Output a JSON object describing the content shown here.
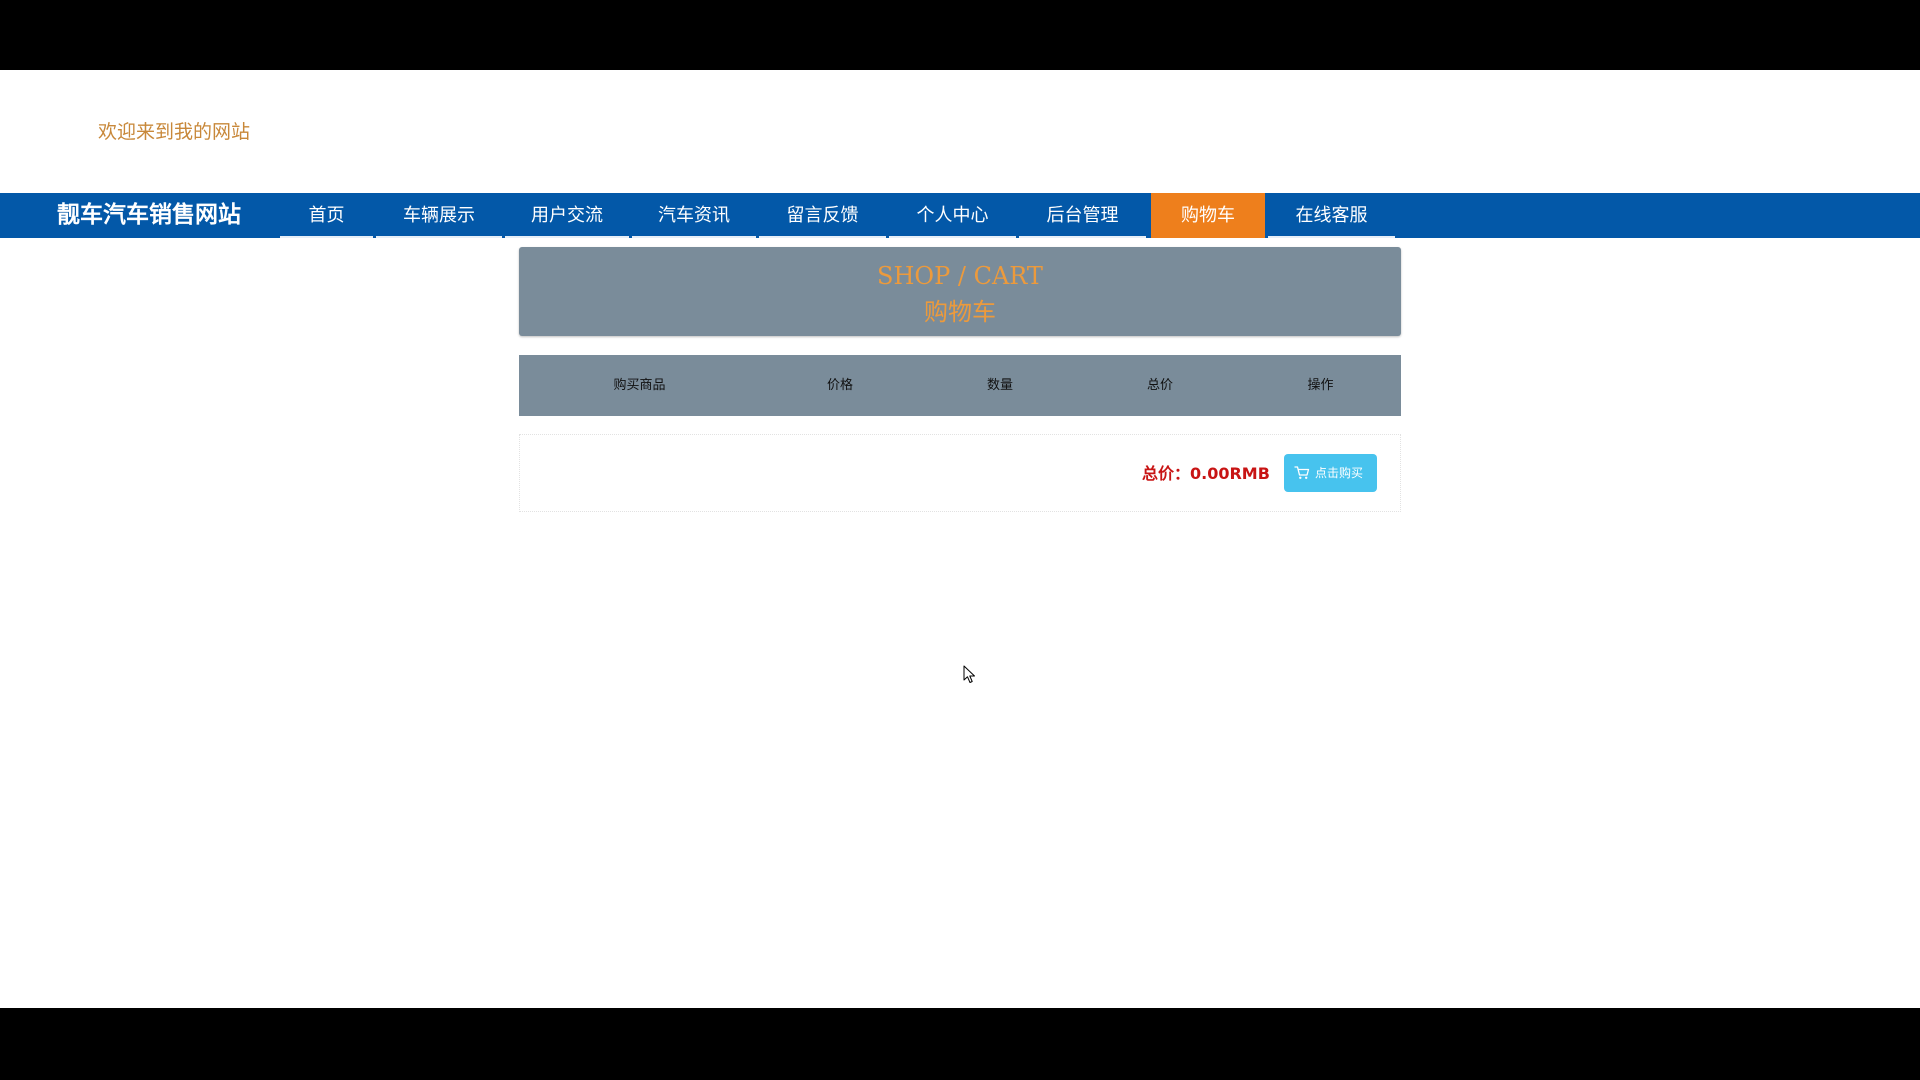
{
  "header": {
    "welcome": "欢迎来到我的网站"
  },
  "nav": {
    "brand": "靓车汽车销售网站",
    "items": [
      {
        "label": "首页",
        "active": false
      },
      {
        "label": "车辆展示",
        "active": false
      },
      {
        "label": "用户交流",
        "active": false
      },
      {
        "label": "汽车资讯",
        "active": false
      },
      {
        "label": "留言反馈",
        "active": false
      },
      {
        "label": "个人中心",
        "active": false
      },
      {
        "label": "后台管理",
        "active": false
      },
      {
        "label": "购物车",
        "active": true
      },
      {
        "label": "在线客服",
        "active": false
      }
    ]
  },
  "banner": {
    "en": "SHOP / CART",
    "cn": "购物车"
  },
  "table": {
    "headers": [
      "购买商品",
      "价格",
      "数量",
      "总价",
      "操作"
    ]
  },
  "summary": {
    "total_label": "总价：0.00RMB",
    "buy_button": "点击购买"
  },
  "colors": {
    "nav_bg": "#0358a8",
    "nav_active": "#ee7f1c",
    "banner_bg": "#7a8c9a",
    "banner_text": "#ec9a3c",
    "total_text": "#c81414",
    "buy_button_bg": "#47c3ee",
    "welcome_text": "#c8883a"
  },
  "icons": {
    "buy_button": "cart-icon",
    "pointer": "mouse-cursor-icon"
  }
}
